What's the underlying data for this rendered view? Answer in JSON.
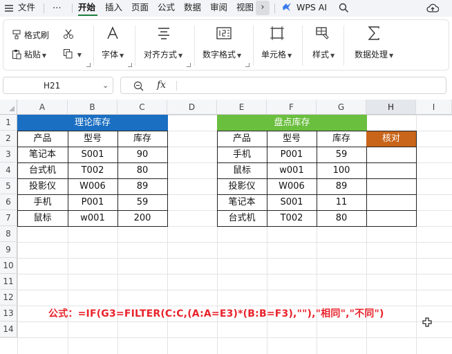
{
  "menu": {
    "items": [
      "文件",
      "⋯",
      "开始",
      "插入",
      "页面",
      "公式",
      "数据",
      "审阅",
      "视图"
    ],
    "active": "开始",
    "wps_ai": "WPS AI",
    "icons": [
      "hamburger-icon",
      "chevron-right-icon",
      "wps-ai-icon",
      "search-icon",
      "cloud-upload-icon"
    ]
  },
  "ribbon": {
    "format_painter": "格式刷",
    "paste": "粘贴",
    "font": "字体",
    "align": "对齐方式",
    "number_format": "数字格式",
    "cell": "单元格",
    "style": "样式",
    "data_process": "数据处理"
  },
  "formula_bar": {
    "name_box": "H21",
    "fx": "fx",
    "content": ""
  },
  "grid": {
    "columns": [
      "A",
      "B",
      "C",
      "D",
      "E",
      "F",
      "G",
      "H",
      "I"
    ],
    "selected_column": "H",
    "rows": [
      "1",
      "2",
      "3",
      "4",
      "5",
      "6",
      "7",
      "8",
      "9",
      "10",
      "11",
      "12",
      "13",
      "14"
    ]
  },
  "table_theory": {
    "title": "理论库存",
    "headers": [
      "产品",
      "型号",
      "库存"
    ],
    "rows": [
      [
        "笔记本",
        "S001",
        "90"
      ],
      [
        "台式机",
        "T002",
        "80"
      ],
      [
        "投影仪",
        "W006",
        "89"
      ],
      [
        "手机",
        "P001",
        "59"
      ],
      [
        "鼠标",
        "w001",
        "200"
      ]
    ]
  },
  "table_count": {
    "title": "盘点库存",
    "headers": [
      "产品",
      "型号",
      "库存",
      "核对"
    ],
    "rows": [
      [
        "手机",
        "P001",
        "59",
        ""
      ],
      [
        "鼠标",
        "w001",
        "100",
        ""
      ],
      [
        "投影仪",
        "W006",
        "89",
        ""
      ],
      [
        "笔记本",
        "S001",
        "11",
        ""
      ],
      [
        "台式机",
        "T002",
        "80",
        ""
      ]
    ]
  },
  "formula_note": "公式：=IF(G3=FILTER(C:C,(A:A=E3)*(B:B=F3),\"\"),\"相同\",\"不同\")",
  "colors": {
    "title_blue": "#1b6fc2",
    "title_green": "#6bbf3f",
    "header_orange": "#c8651a",
    "formula_red": "#e8232b",
    "active_tab": "#1a7f3c"
  }
}
